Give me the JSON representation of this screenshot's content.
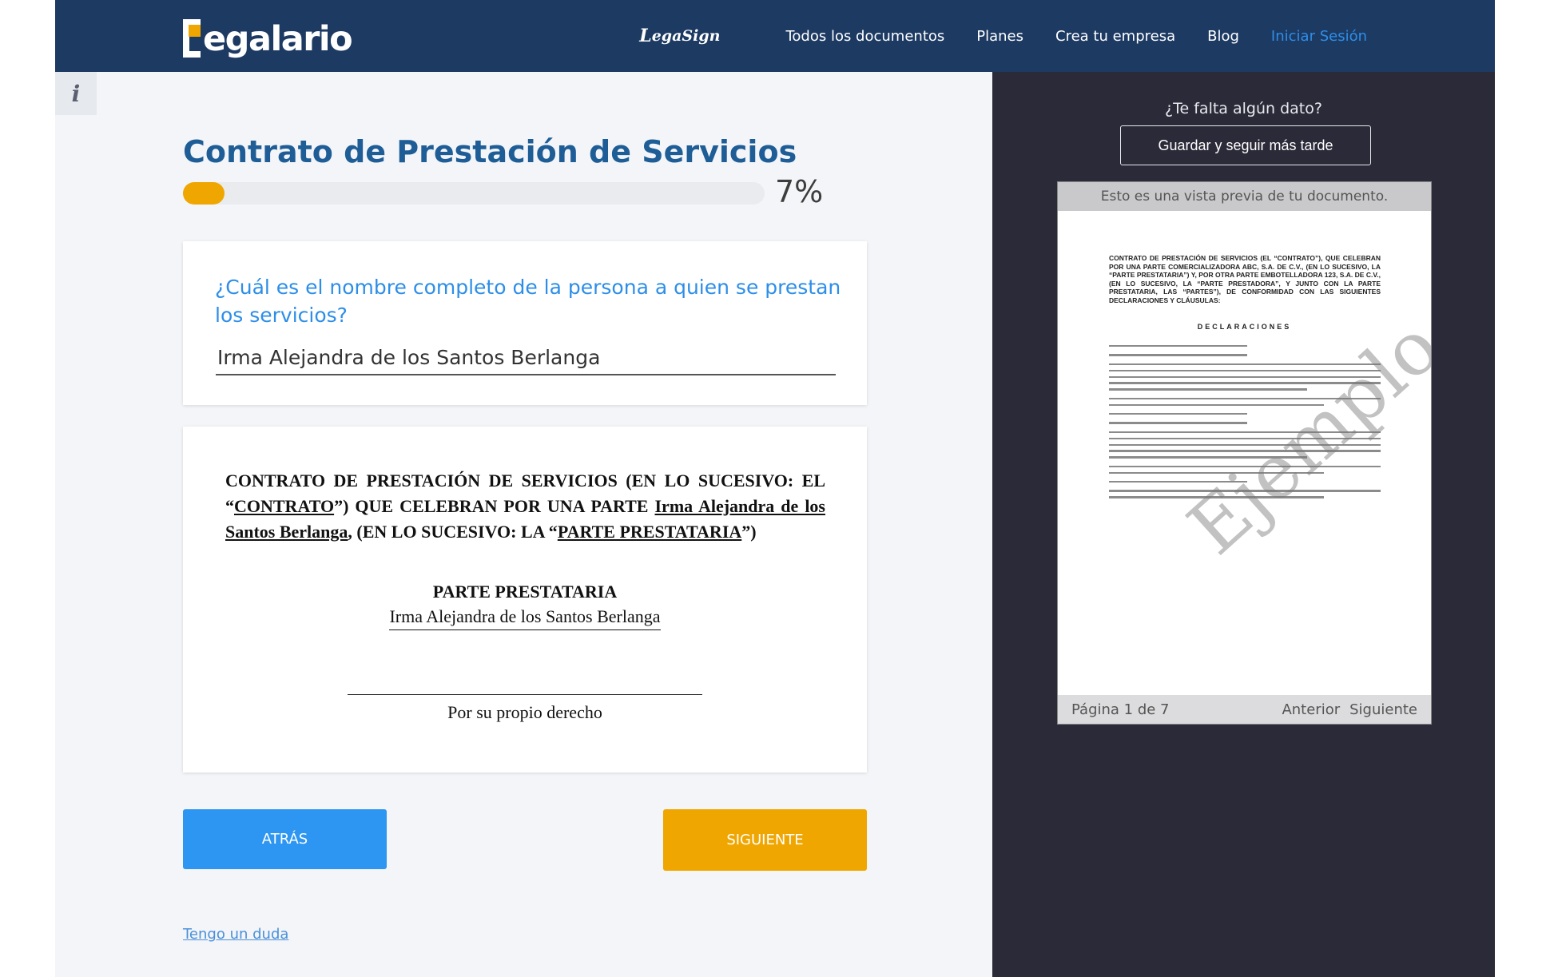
{
  "header": {
    "logo_text": "egalario",
    "brand_label": "egaSign",
    "nav": {
      "all_docs": "Todos los documentos",
      "plans": "Planes",
      "create_company": "Crea tu empresa",
      "blog": "Blog",
      "login": "Iniciar Sesión"
    }
  },
  "info_icon": "i",
  "form": {
    "title": "Contrato de Prestación de Servicios",
    "progress_label": "7%",
    "progress_value": 0.07,
    "question": "¿Cuál es el nombre completo de la persona a quien se prestan los servicios?",
    "answer": "Irma Alejandra de los Santos Berlanga"
  },
  "doc_preview": {
    "text_1": "CONTRATO DE PRESTACIÓN DE SERVICIOS (EN LO SUCESIVO: EL “",
    "contrato": "CONTRATO",
    "text_2": "”) QUE CELEBRAN POR UNA PARTE ",
    "name": "Irma Alejandra de los Santos Berlanga",
    "text_3": ", (EN LO SUCESIVO: LA “",
    "parte_prestataria": "PARTE PRESTATARIA",
    "text_4": "”)",
    "party_heading": "PARTE PRESTATARIA",
    "party_name": "Irma Alejandra de los Santos Berlanga",
    "signature_caption": "Por su propio derecho"
  },
  "buttons": {
    "back": "ATRÁS",
    "next": "SIGUIENTE",
    "doubt": "Tengo un duda"
  },
  "sidebar": {
    "missing_prompt": "¿Te falta algún dato?",
    "save_later": "Guardar y seguir más tarde",
    "preview_header": "Esto es una vista previa de tu documento.",
    "preview_title": "CONTRATO DE PRESTACIÓN DE SERVICIOS (EL “CONTRATO”), QUE CELEBRAN POR UNA PARTE COMERCIALIZADORA ABC, S.A. DE C.V., (EN LO SUCESIVO, LA “PARTE PRESTATARIA”) Y, POR OTRA PARTE EMBOTELLADORA 123, S.A. DE C.V., (EN LO SUCESIVO, LA “PARTE PRESTADORA”, Y JUNTO CON LA PARTE PRESTATARIA, LAS “PARTES”), DE CONFORMIDAD CON LAS SIGUIENTES DECLARACIONES Y CLÁUSULAS:",
    "preview_section": "DECLARACIONES",
    "watermark": "Ejemplo",
    "page_label": "Página 1 de 7",
    "prev": "Anterior",
    "next": "Siguiente"
  },
  "colors": {
    "header_bg": "#1d3a63",
    "accent_blue": "#2d8ee8",
    "accent_orange": "#f0a600",
    "sidebar_bg": "#2b2a38"
  }
}
